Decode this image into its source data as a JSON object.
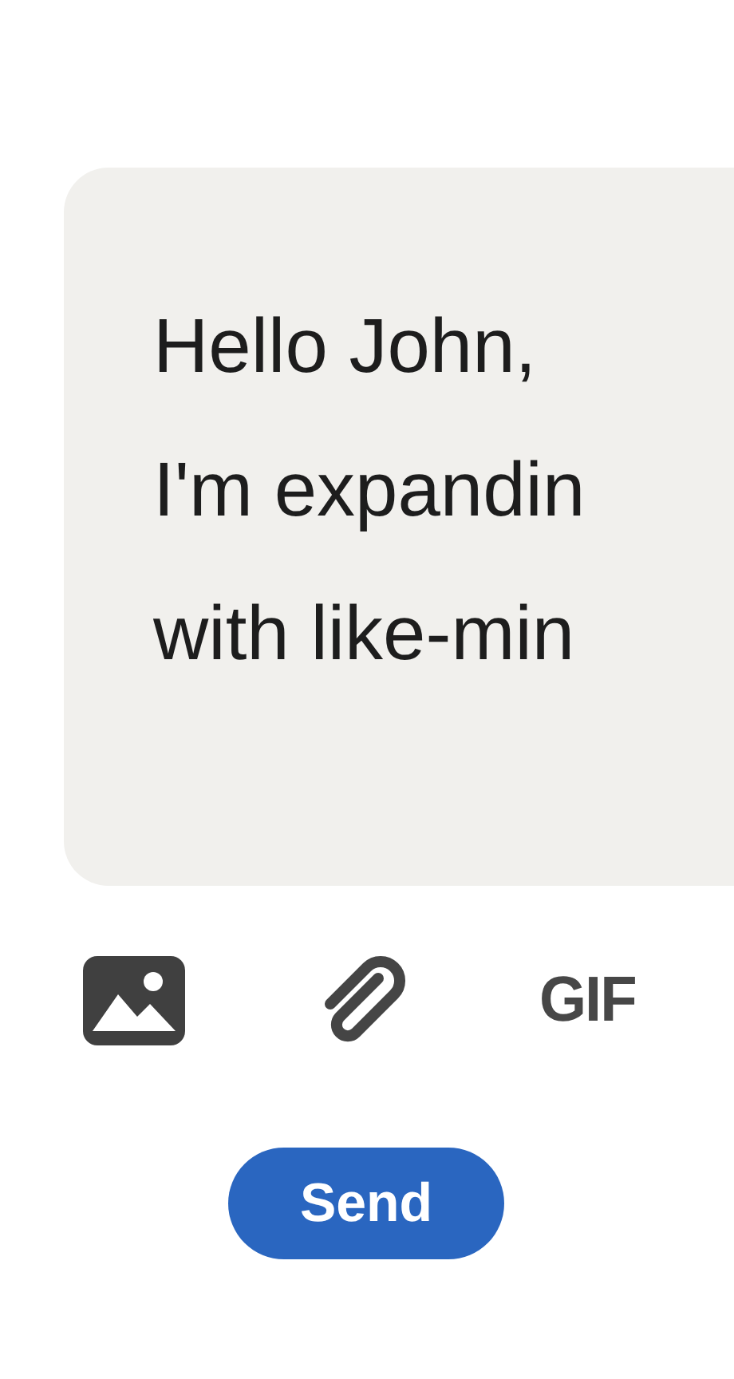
{
  "message": {
    "lines": [
      "Hello John,",
      "I'm expandin",
      "with like-min"
    ]
  },
  "toolbar": [
    {
      "kind": "image"
    },
    {
      "kind": "attachment"
    },
    {
      "kind": "gif",
      "label": "GIF"
    }
  ],
  "send_button": {
    "label": "Send"
  }
}
